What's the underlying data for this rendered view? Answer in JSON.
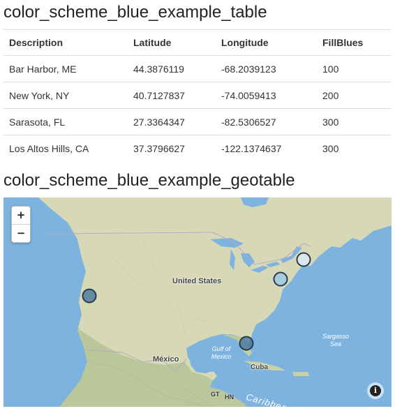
{
  "table_section": {
    "title": "color_scheme_blue_example_table",
    "columns": [
      "Description",
      "Latitude",
      "Longitude",
      "FillBlues"
    ],
    "rows": [
      [
        "Bar Harbor, ME",
        "44.3876119",
        "-68.2039123",
        "100"
      ],
      [
        "New York, NY",
        "40.7127837",
        "-74.0059413",
        "200"
      ],
      [
        "Sarasota, FL",
        "27.3364347",
        "-82.5306527",
        "300"
      ],
      [
        "Los Altos Hills, CA",
        "37.3796627",
        "-122.1374637",
        "300"
      ]
    ]
  },
  "geo_section": {
    "title": "color_scheme_blue_example_geotable",
    "zoom_in": "+",
    "zoom_out": "−",
    "info": "i",
    "labels": {
      "us": "United States",
      "mexico": "México",
      "cuba": "Cuba",
      "gulf": "Gulf of Mexico",
      "sargasso": "Sargasso Sea",
      "caribbean": "Caribbean Sea",
      "gt": "GT",
      "hn": "HN"
    },
    "markers": [
      {
        "name": "Bar Harbor, ME",
        "fill_value": 100,
        "color": "#dbe9f6"
      },
      {
        "name": "New York, NY",
        "fill_value": 200,
        "color": "#9ecae1"
      },
      {
        "name": "Sarasota, FL",
        "fill_value": 300,
        "color": "#3d6f9e"
      },
      {
        "name": "Los Altos Hills, CA",
        "fill_value": 300,
        "color": "#3d6f9e"
      }
    ]
  }
}
